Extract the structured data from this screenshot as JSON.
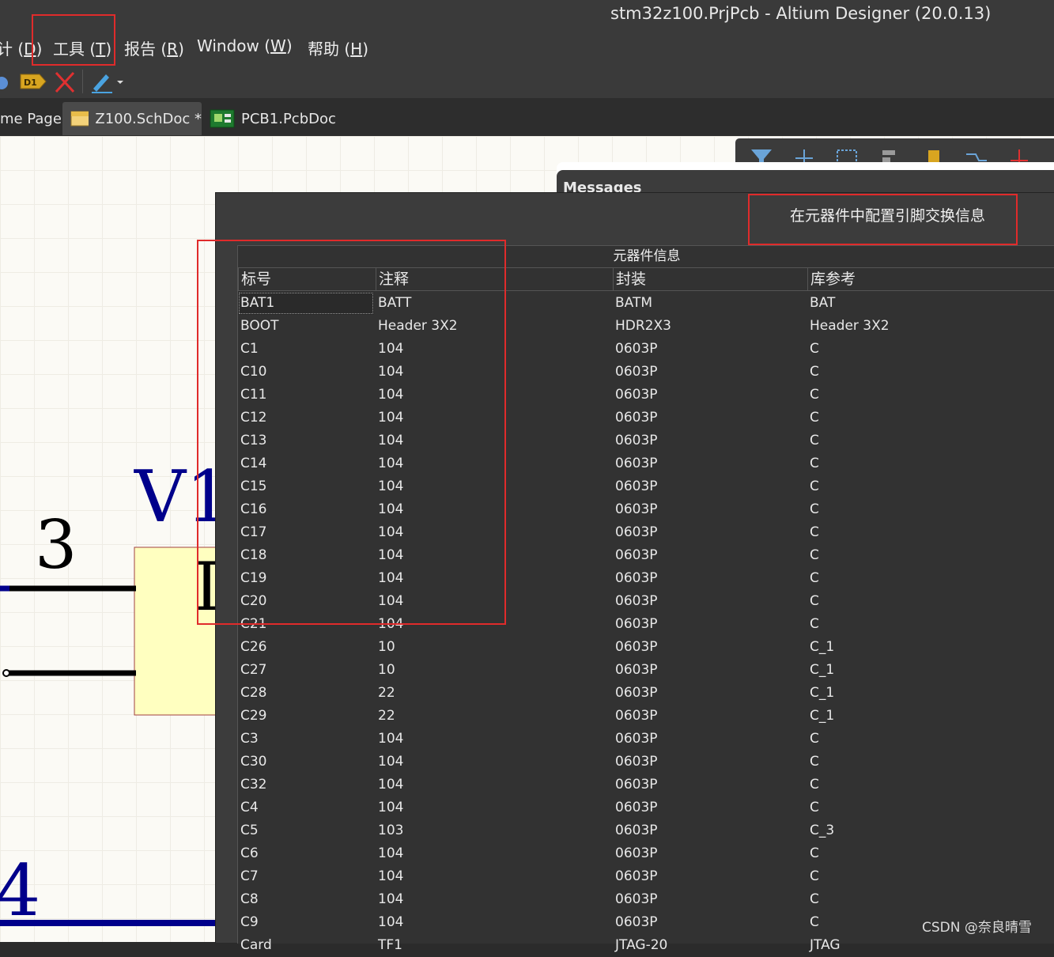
{
  "window": {
    "title": "stm32z100.PrjPcb - Altium Designer (20.0.13)"
  },
  "menu": {
    "items": [
      {
        "label": "计 (",
        "accel": "D",
        "tail": ")"
      },
      {
        "label": "工具 (",
        "accel": "T",
        "tail": ")"
      },
      {
        "label": "报告 (",
        "accel": "R",
        "tail": ")"
      },
      {
        "label": "Window (",
        "accel": "W",
        "tail": ")"
      },
      {
        "label": "帮助 (",
        "accel": "H",
        "tail": ")"
      }
    ]
  },
  "toolbar": {
    "designator_badge": "D1"
  },
  "tabs": [
    {
      "label": "me Page"
    },
    {
      "label": "Z100.SchDoc *"
    },
    {
      "label": "PCB1.PcbDoc"
    }
  ],
  "schematic": {
    "part_label": "V1",
    "pin_upper": "3",
    "pin_lower": "4",
    "body_text": "I"
  },
  "messages_panel": {
    "title": "Messages"
  },
  "dialog": {
    "title": "在元器件中配置引脚交换信息",
    "group_header": "元器件信息",
    "columns": [
      "标号",
      "注释",
      "封装",
      "库参考"
    ],
    "rows": [
      [
        "BAT1",
        "BATT",
        "BATM",
        "BAT"
      ],
      [
        "BOOT",
        "Header 3X2",
        "HDR2X3",
        "Header 3X2"
      ],
      [
        "C1",
        "104",
        "0603P",
        "C"
      ],
      [
        "C10",
        "104",
        "0603P",
        "C"
      ],
      [
        "C11",
        "104",
        "0603P",
        "C"
      ],
      [
        "C12",
        "104",
        "0603P",
        "C"
      ],
      [
        "C13",
        "104",
        "0603P",
        "C"
      ],
      [
        "C14",
        "104",
        "0603P",
        "C"
      ],
      [
        "C15",
        "104",
        "0603P",
        "C"
      ],
      [
        "C16",
        "104",
        "0603P",
        "C"
      ],
      [
        "C17",
        "104",
        "0603P",
        "C"
      ],
      [
        "C18",
        "104",
        "0603P",
        "C"
      ],
      [
        "C19",
        "104",
        "0603P",
        "C"
      ],
      [
        "C20",
        "104",
        "0603P",
        "C"
      ],
      [
        "C21",
        "104",
        "0603P",
        "C"
      ],
      [
        "C26",
        "10",
        "0603P",
        "C_1"
      ],
      [
        "C27",
        "10",
        "0603P",
        "C_1"
      ],
      [
        "C28",
        "22",
        "0603P",
        "C_1"
      ],
      [
        "C29",
        "22",
        "0603P",
        "C_1"
      ],
      [
        "C3",
        "104",
        "0603P",
        "C"
      ],
      [
        "C30",
        "104",
        "0603P",
        "C"
      ],
      [
        "C32",
        "104",
        "0603P",
        "C"
      ],
      [
        "C4",
        "104",
        "0603P",
        "C"
      ],
      [
        "C5",
        "103",
        "0603P",
        "C_3"
      ],
      [
        "C6",
        "104",
        "0603P",
        "C"
      ],
      [
        "C7",
        "104",
        "0603P",
        "C"
      ],
      [
        "C8",
        "104",
        "0603P",
        "C"
      ],
      [
        "C9",
        "104",
        "0603P",
        "C"
      ],
      [
        "Card",
        "TF1",
        "JTAG-20",
        "JTAG"
      ]
    ]
  },
  "watermark": "CSDN @奈良晴雪",
  "colors": {
    "highlight": "#e02b2b",
    "wire_blue": "#00008b",
    "part_fill": "#ffffc0"
  }
}
